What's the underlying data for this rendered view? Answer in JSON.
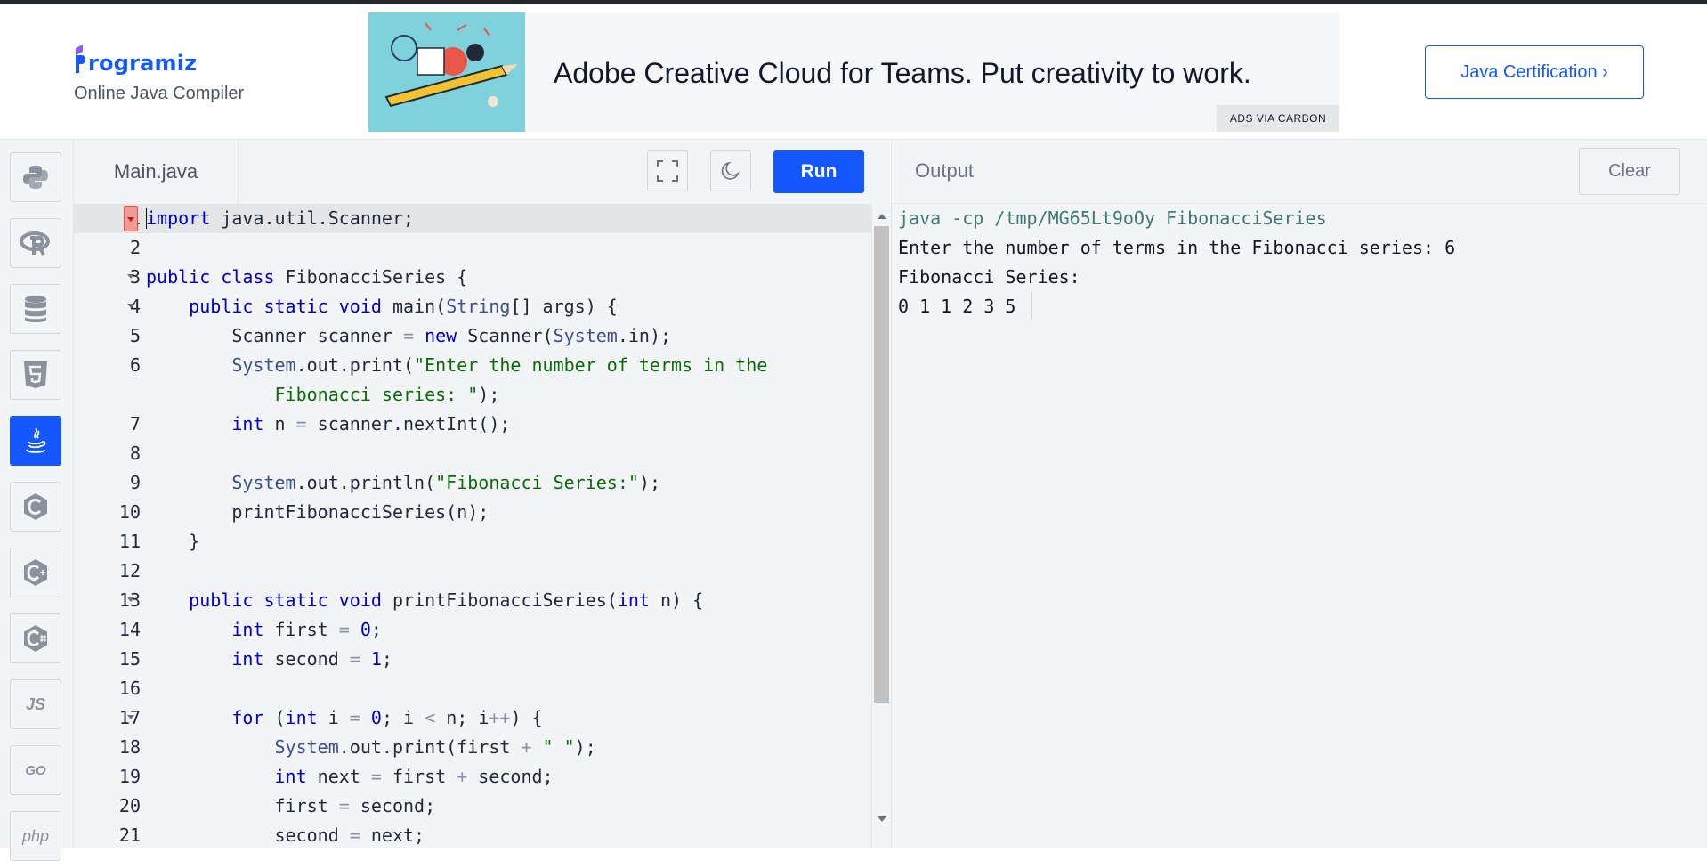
{
  "header": {
    "logo_text": "rogramiz",
    "subtitle": "Online Java Compiler",
    "ad_text": "Adobe Creative Cloud for Teams. Put creativity to work.",
    "ad_via": "ADS VIA CARBON",
    "certification_button": "Java Certification ›"
  },
  "sidebar": {
    "items": [
      {
        "name": "python",
        "icon": "python-icon"
      },
      {
        "name": "r",
        "icon": "r-icon"
      },
      {
        "name": "sql",
        "icon": "database-icon"
      },
      {
        "name": "html",
        "icon": "html5-icon"
      },
      {
        "name": "java",
        "icon": "java-icon",
        "active": true
      },
      {
        "name": "c",
        "icon": "c-icon"
      },
      {
        "name": "cpp",
        "icon": "cpp-icon"
      },
      {
        "name": "csharp",
        "icon": "csharp-icon"
      },
      {
        "name": "js",
        "label": "JS"
      },
      {
        "name": "go",
        "label": "GO"
      },
      {
        "name": "php",
        "label": "php"
      }
    ]
  },
  "editor": {
    "file_tab": "Main.java",
    "run_label": "Run",
    "line_numbers": [
      "1",
      "2",
      "3",
      "4",
      "5",
      "6",
      "",
      "7",
      "8",
      "9",
      "10",
      "11",
      "12",
      "13",
      "14",
      "15",
      "16",
      "17",
      "18",
      "19",
      "20",
      "21"
    ]
  },
  "output": {
    "title": "Output",
    "clear_label": "Clear",
    "command": "java -cp /tmp/MG65Lt9oOy FibonacciSeries",
    "lines": [
      "Enter the number of terms in the Fibonacci series: 6",
      "Fibonacci Series:",
      "0 1 1 2 3 5 "
    ]
  },
  "colors": {
    "brand_blue": "#1557ff",
    "keyword": "#0000cc",
    "string": "#0b6b0b",
    "output_command": "#3c7a72"
  }
}
